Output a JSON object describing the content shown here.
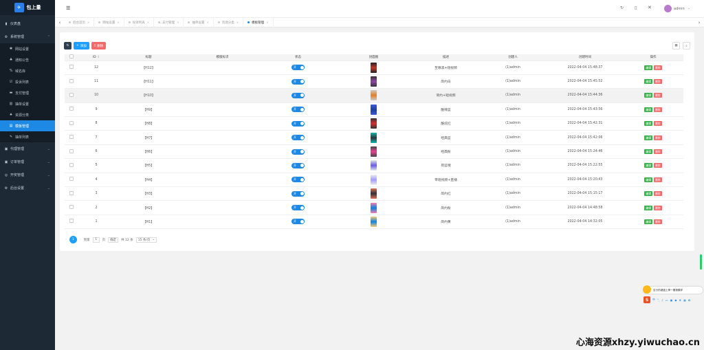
{
  "sidebar": {
    "logo_text": "包上量",
    "items": [
      {
        "label": "仪表盘",
        "icon": "dashboard-icon"
      },
      {
        "label": "系统管理",
        "icon": "gear-icon",
        "expanded": true
      },
      {
        "label": "代理管理",
        "icon": "user-icon"
      },
      {
        "label": "订单管理",
        "icon": "order-icon"
      },
      {
        "label": "开奖管理",
        "icon": "lottery-icon"
      },
      {
        "label": "后台设置",
        "icon": "settings-icon"
      }
    ],
    "sub_items": [
      {
        "label": "网站设置"
      },
      {
        "label": "通知公告"
      },
      {
        "label": "域名库"
      },
      {
        "label": "投诉列表"
      },
      {
        "label": "支付管理"
      },
      {
        "label": "抽单设置"
      },
      {
        "label": "资源分类"
      },
      {
        "label": "模板管理",
        "active": true
      },
      {
        "label": "抽单列表"
      }
    ]
  },
  "topbar": {
    "user": "admin"
  },
  "tabs": [
    {
      "label": "后台首页"
    },
    {
      "label": "网站设置"
    },
    {
      "label": "投诉列表"
    },
    {
      "label": "支付管理"
    },
    {
      "label": "抽单设置"
    },
    {
      "label": "资源分类"
    },
    {
      "label": "模板管理",
      "active": true
    }
  ],
  "toolbar": {
    "add_label": "添加",
    "delete_label": "删除"
  },
  "table": {
    "headers": [
      "ID",
      "标题",
      "模版标识",
      "状态",
      "封面图",
      "描述",
      "创建人",
      "创建时间",
      "操作"
    ],
    "switch_on": "开",
    "edit_label": "编辑",
    "delete_label": "删除",
    "rows": [
      {
        "id": "12",
        "title": "【H12】",
        "ident": "",
        "desc": "至尊黑+短视频",
        "creator": "(1)admin",
        "time": "2022-04-04 15:48:37",
        "colors": [
          "#222",
          "#c0392b"
        ]
      },
      {
        "id": "11",
        "title": "【H11】",
        "ident": "",
        "desc": "简约白",
        "creator": "(1)admin",
        "time": "2022-04-04 15:45:52",
        "colors": [
          "#333",
          "#8e44ad"
        ]
      },
      {
        "id": "10",
        "title": "【H10】",
        "ident": "",
        "desc": "简约+短视频",
        "creator": "(1)admin",
        "time": "2022-04-04 15:44:36",
        "colors": [
          "#ccc",
          "#e67e22"
        ]
      },
      {
        "id": "9",
        "title": "【H9】",
        "ident": "",
        "desc": "酷辣蓝",
        "creator": "(1)admin",
        "time": "2022-04-04 15:43:56",
        "colors": [
          "#3b5bdb",
          "#1f3f99"
        ]
      },
      {
        "id": "8",
        "title": "【H8】",
        "ident": "",
        "desc": "酷炫红",
        "creator": "(1)admin",
        "time": "2022-04-04 15:42:31",
        "colors": [
          "#333",
          "#d63031"
        ]
      },
      {
        "id": "7",
        "title": "【H7】",
        "ident": "",
        "desc": "经典蓝",
        "creator": "(1)admin",
        "time": "2022-04-04 15:42:06",
        "colors": [
          "#0fb9b1",
          "#2d3436"
        ]
      },
      {
        "id": "6",
        "title": "【H6】",
        "ident": "",
        "desc": "经典粉",
        "creator": "(1)admin",
        "time": "2022-04-04 15:24:46",
        "colors": [
          "#444",
          "#e84393"
        ]
      },
      {
        "id": "5",
        "title": "【H5】",
        "ident": "",
        "desc": "荷蓝嘿",
        "creator": "(1)admin",
        "time": "2022-04-04 15:22:55",
        "colors": [
          "#dfe6e9",
          "#6c5ce7"
        ]
      },
      {
        "id": "4",
        "title": "【H4】",
        "ident": "",
        "desc": "带短视频+直播",
        "creator": "(1)admin",
        "time": "2022-04-04 15:20:43",
        "colors": [
          "#eee",
          "#a29bfe"
        ]
      },
      {
        "id": "3",
        "title": "【H3】",
        "ident": "",
        "desc": "简约红",
        "creator": "(1)admin",
        "time": "2022-04-04 15:15:17",
        "colors": [
          "#e17055",
          "#2d3436"
        ]
      },
      {
        "id": "2",
        "title": "【H2】",
        "ident": "",
        "desc": "简约粉",
        "creator": "(1)admin",
        "time": "2022-04-04 14:48:58",
        "colors": [
          "#fd79a8",
          "#0984e3"
        ]
      },
      {
        "id": "1",
        "title": "【H1】",
        "ident": "",
        "desc": "简约黄",
        "creator": "(1)admin",
        "time": "2022-04-04 14:32:05",
        "colors": [
          "#fdcb6e",
          "#0984e3"
        ]
      }
    ]
  },
  "pager": {
    "current": "1",
    "goto_prefix": "到第",
    "goto_value": "1",
    "goto_suffix": "页",
    "confirm": "确定",
    "total": "共 12 条",
    "page_size": "15 条/页"
  },
  "ime": {
    "tip": "百分的键盘上神一樱报模样",
    "brand": "S"
  },
  "watermark": "心海资源xhzy.yiwuchao.cn"
}
